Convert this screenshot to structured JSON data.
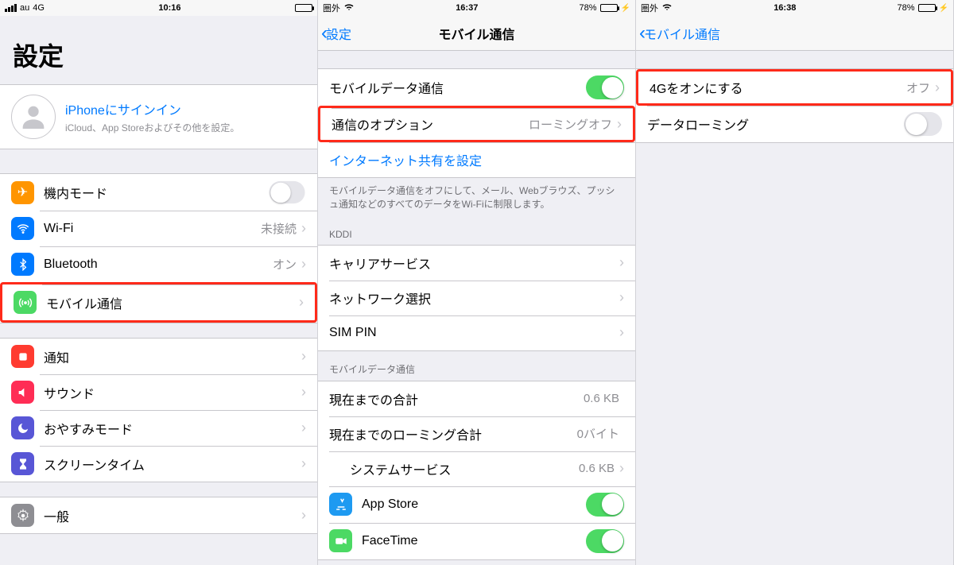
{
  "screen1": {
    "status": {
      "carrier": "au",
      "net": "4G",
      "time": "10:16"
    },
    "title": "設定",
    "signin": {
      "title": "iPhoneにサインイン",
      "subtitle": "iCloud、App Storeおよびその他を設定。"
    },
    "group1": {
      "airplane": "機内モード",
      "wifi": "Wi-Fi",
      "wifi_detail": "未接続",
      "bluetooth": "Bluetooth",
      "bluetooth_detail": "オン",
      "cellular": "モバイル通信"
    },
    "group2": {
      "notifications": "通知",
      "sounds": "サウンド",
      "dnd": "おやすみモード",
      "screentime": "スクリーンタイム"
    },
    "group3": {
      "general": "一般"
    }
  },
  "screen2": {
    "status": {
      "carrier": "圏外",
      "time": "16:37",
      "battery": "78%"
    },
    "nav": {
      "back": "設定",
      "title": "モバイル通信"
    },
    "g1": {
      "mobile_data": "モバイルデータ通信",
      "comm_options": "通信のオプション",
      "comm_options_detail": "ローミングオフ",
      "hotspot": "インターネット共有を設定"
    },
    "footer1": "モバイルデータ通信をオフにして、メール、Webブラウズ、プッシュ通知などのすべてのデータをWi-Fiに制限します。",
    "kddi_header": "KDDI",
    "g2": {
      "carrier_services": "キャリアサービス",
      "network_select": "ネットワーク選択",
      "sim_pin": "SIM PIN"
    },
    "data_header": "モバイルデータ通信",
    "g3": {
      "total": "現在までの合計",
      "total_val": "0.6 KB",
      "roaming_total": "現在までのローミング合計",
      "roaming_val": "0バイト",
      "system_services": "システムサービス",
      "system_val": "0.6 KB",
      "appstore": "App Store",
      "facetime": "FaceTime"
    }
  },
  "screen3": {
    "status": {
      "carrier": "圏外",
      "time": "16:38",
      "battery": "78%"
    },
    "nav": {
      "back": "モバイル通信"
    },
    "g1": {
      "enable_4g": "4Gをオンにする",
      "enable_4g_detail": "オフ",
      "data_roaming": "データローミング"
    }
  }
}
